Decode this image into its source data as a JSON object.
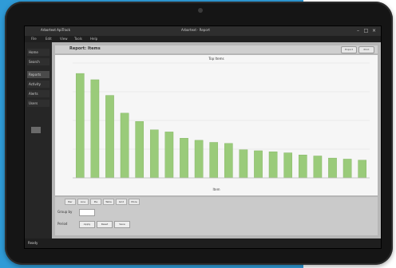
{
  "window": {
    "app_title": "Arbortext ApiTrack",
    "title": "Arbortext · Report"
  },
  "menu": [
    "File",
    "Edit",
    "View",
    "Tools",
    "Help"
  ],
  "sidebar": {
    "items": [
      {
        "label": "Home"
      },
      {
        "label": "Search"
      },
      {
        "label": "Reports"
      },
      {
        "label": "Activity"
      },
      {
        "label": "Alerts"
      },
      {
        "label": "Users"
      }
    ]
  },
  "main": {
    "title": "Report: Items",
    "controls": [
      "Export",
      "Print"
    ],
    "chart_title": "Top Items",
    "xlabel": "Item",
    "bottom": {
      "tabs": [
        "Bar",
        "Line",
        "Pie",
        "Table",
        "Grid",
        "More"
      ],
      "row1_label": "Group by",
      "row2_label": "Period",
      "buttons": [
        "Apply",
        "Reset",
        "Save"
      ]
    }
  },
  "status": {
    "left": "Ready",
    "right": ""
  },
  "chart_data": {
    "type": "bar",
    "categories": [
      "",
      "",
      "",
      "",
      "",
      "",
      "",
      "",
      "",
      "",
      "",
      "",
      "",
      "",
      "",
      "",
      "",
      "",
      "",
      ""
    ],
    "values": [
      100,
      94,
      79,
      62,
      54,
      46,
      44,
      38,
      36,
      34,
      33,
      27,
      26,
      25,
      24,
      22,
      21,
      19,
      18,
      17
    ],
    "title": "Top Items",
    "xlabel": "Item",
    "ylabel": "",
    "ylim": [
      0,
      110
    ],
    "grid": true,
    "colors": {
      "bar": "#9acb7a"
    }
  },
  "colors": {
    "desktop": "#2f9bd7"
  }
}
